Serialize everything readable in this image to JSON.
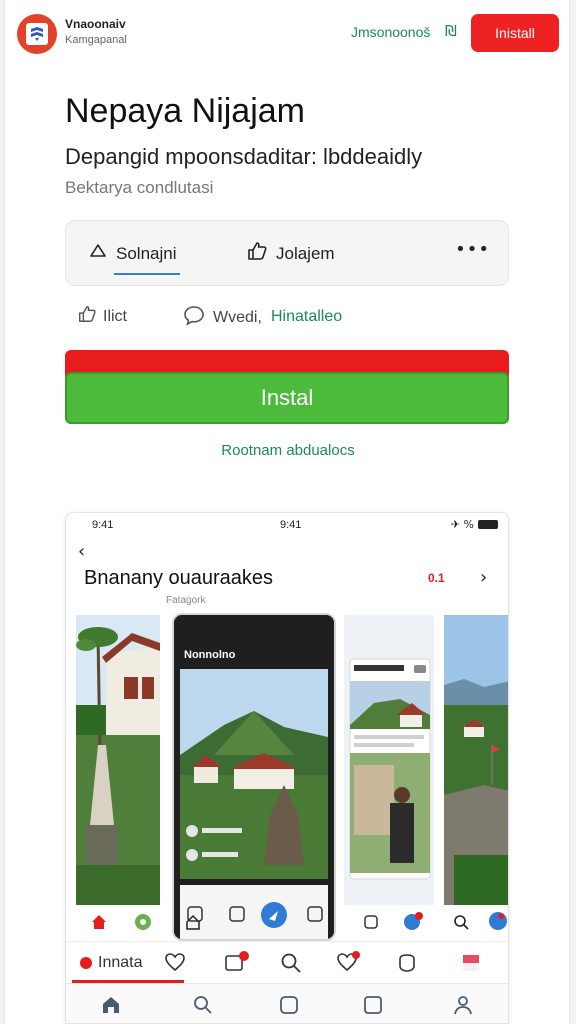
{
  "header": {
    "developer_name": "Vnaoonaiv",
    "developer_sub": "Kamgapanal",
    "top_link": "Jmsonoonoš",
    "top_link_icon": "₪",
    "install_label": "Inistall",
    "logo_icon": "app-logo-icon"
  },
  "app": {
    "title": "Nepaya Nijajam",
    "subtitle": "Depangid mpoonsdaditar: lbddeaidly",
    "meta": "Bektarya condlutasi"
  },
  "tabs": {
    "tab1_label": "Solnajni",
    "tab2_label": "Jolajem",
    "more_label": "•••"
  },
  "actions": {
    "like_label": "Ilict",
    "comment_label": "Wvedi,",
    "link_label": "Hinatalleo"
  },
  "install": {
    "label": "Instal",
    "note": "Rootnam abdualocs"
  },
  "screenshot": {
    "time_left": "9:41",
    "time_center": "9:41",
    "status_right": "✈ %",
    "title": "Bnanany ouauraakes",
    "subtitle": "Fatagork",
    "badge": "0.1",
    "phone_header": "Nonnolno",
    "nav_label": "Innata"
  },
  "colors": {
    "accent_red": "#ee2223",
    "install_green": "#4cbb3c",
    "link_green": "#1a8a5c",
    "tab_underline": "#3a7bd5"
  }
}
